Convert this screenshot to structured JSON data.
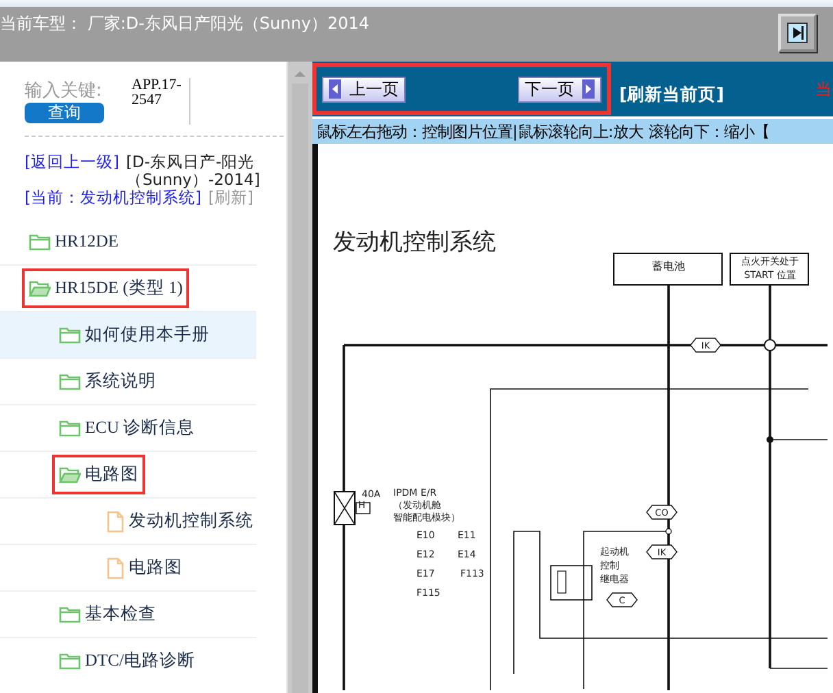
{
  "header": {
    "title": "当前车型： 厂家:D-东风日产阳光（Sunny）2014"
  },
  "search": {
    "label": "输入关键:",
    "button": "查询",
    "code": "APP.17-2547"
  },
  "breadcrumb": {
    "back": "[返回上一级]",
    "model": "[D-东风日产-阳光（Sunny）-2014]",
    "current": "[当前：发动机控制系统]",
    "refresh": "[刷新]"
  },
  "tree": [
    {
      "label": "HR12DE",
      "kind": "folder",
      "expanded": false,
      "selected": false,
      "highlighted": false
    },
    {
      "label": "HR15DE (类型 1)",
      "kind": "folder",
      "expanded": true,
      "selected": false,
      "highlighted": true,
      "children": [
        {
          "label": "如何使用本手册",
          "kind": "folder",
          "expanded": false,
          "selected": true,
          "highlighted": false
        },
        {
          "label": "系统说明",
          "kind": "folder",
          "expanded": false,
          "selected": false,
          "highlighted": false
        },
        {
          "label": "ECU 诊断信息",
          "kind": "folder",
          "expanded": false,
          "selected": false,
          "highlighted": false
        },
        {
          "label": "电路图",
          "kind": "folder",
          "expanded": true,
          "selected": false,
          "highlighted": true,
          "children": [
            {
              "label": "发动机控制系统",
              "kind": "file",
              "selected": false,
              "highlighted": false
            },
            {
              "label": "电路图",
              "kind": "file",
              "selected": false,
              "highlighted": false
            }
          ]
        },
        {
          "label": "基本检查",
          "kind": "folder",
          "expanded": false,
          "selected": false,
          "highlighted": false
        },
        {
          "label": "DTC/电路诊断",
          "kind": "folder",
          "expanded": false,
          "selected": false,
          "highlighted": false
        }
      ]
    }
  ],
  "toolbar": {
    "prev": "上一页",
    "next": "下一页",
    "nav_highlighted": true,
    "refresh": "[刷新当前页]",
    "cut_text": "当"
  },
  "hint": "鼠标左右拖动：控制图片位置|鼠标滚轮向上:放大  滚轮向下：缩小【",
  "diagram": {
    "title": "发动机控制系统",
    "labels": [
      "蓄电池",
      "点火开关处于",
      "START 位置",
      "IK",
      "CO",
      "IK",
      "40A",
      "H",
      "IPDM E/R",
      "（发动机舱",
      "智能配电模块）",
      "E10",
      "E11",
      "E12",
      "E14",
      "E17",
      "F113",
      "F115",
      "起动机",
      "控制",
      "继电器",
      "C"
    ]
  }
}
